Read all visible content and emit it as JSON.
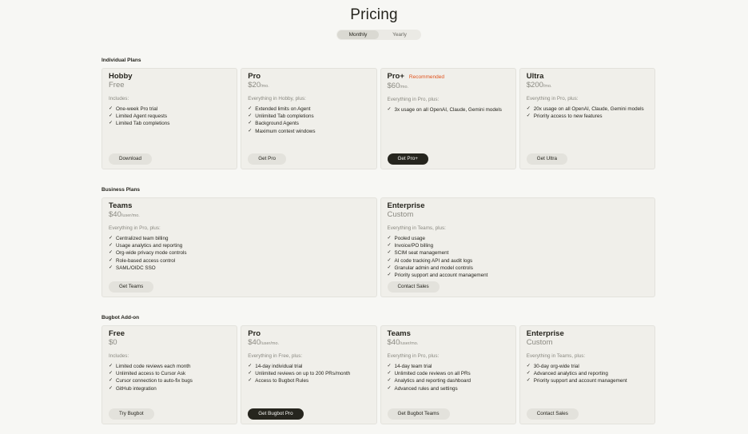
{
  "page": {
    "title": "Pricing",
    "toggle": {
      "monthly": "Monthly",
      "yearly": "Yearly"
    }
  },
  "individual": {
    "label": "Individual Plans",
    "plans": [
      {
        "name": "Hobby",
        "price": "Free",
        "unit": "",
        "intro": "Includes:",
        "features": [
          "One-week Pro trial",
          "Limited Agent requests",
          "Limited Tab completions"
        ],
        "button": "Download"
      },
      {
        "name": "Pro",
        "price": "$20",
        "unit": "/mo.",
        "intro": "Everything in Hobby, plus:",
        "features": [
          "Extended limits on Agent",
          "Unlimited Tab completions",
          "Background Agents",
          "Maximum context windows"
        ],
        "button": "Get Pro"
      },
      {
        "name": "Pro+",
        "badge": "Recommended",
        "price": "$60",
        "unit": "/mo.",
        "intro": "Everything in Pro, plus:",
        "features": [
          "3x usage on all OpenAI, Claude, Gemini models"
        ],
        "button": "Get Pro+"
      },
      {
        "name": "Ultra",
        "price": "$200",
        "unit": "/mo.",
        "intro": "Everything in Pro, plus:",
        "features": [
          "20x usage on all OpenAI, Claude, Gemini models",
          "Priority access to new features"
        ],
        "button": "Get Ultra"
      }
    ]
  },
  "business": {
    "label": "Business Plans",
    "plans": [
      {
        "name": "Teams",
        "price": "$40",
        "unit": "/user/mo.",
        "intro": "Everything in Pro, plus:",
        "features": [
          "Centralized team billing",
          "Usage analytics and reporting",
          "Org-wide privacy mode controls",
          "Role-based access control",
          "SAML/OIDC SSO"
        ],
        "button": "Get Teams"
      },
      {
        "name": "Enterprise",
        "price": "Custom",
        "unit": "",
        "intro": "Everything in Teams, plus:",
        "features": [
          "Pooled usage",
          "Invoice/PO billing",
          "SCIM seat management",
          "AI code tracking API and audit logs",
          "Granular admin and model controls",
          "Priority support and account management"
        ],
        "button": "Contact Sales"
      }
    ]
  },
  "bugbot": {
    "label": "Bugbot Add-on",
    "plans": [
      {
        "name": "Free",
        "price": "$0",
        "unit": "",
        "intro": "Includes:",
        "features": [
          "Limited code reviews each month",
          "Unlimited access to Cursor Ask",
          "Cursor connection to auto-fix bugs",
          "GitHub integration"
        ],
        "button": "Try Bugbot"
      },
      {
        "name": "Pro",
        "price": "$40",
        "unit": "/user/mo.",
        "intro": "Everything in Free, plus:",
        "features": [
          "14-day individual trial",
          "Unlimited reviews on up to 200 PRs/month",
          "Access to Bugbot Rules"
        ],
        "button": "Get Bugbot Pro"
      },
      {
        "name": "Teams",
        "price": "$40",
        "unit": "/user/mo.",
        "intro": "Everything in Pro, plus:",
        "features": [
          "14-day team trial",
          "Unlimited code reviews on all PRs",
          "Analytics and reporting dashboard",
          "Advanced rules and settings"
        ],
        "button": "Get Bugbot Teams"
      },
      {
        "name": "Enterprise",
        "price": "Custom",
        "unit": "",
        "intro": "Everything in Teams, plus:",
        "features": [
          "30-day org-wide trial",
          "Advanced analytics and reporting",
          "Priority support and account management"
        ],
        "button": "Contact Sales"
      }
    ]
  }
}
